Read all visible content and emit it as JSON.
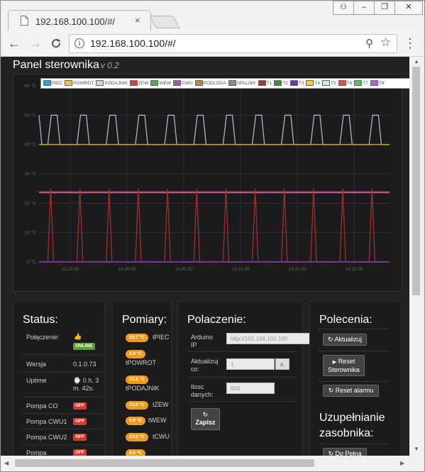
{
  "browser": {
    "tab_title": "192.168.100.100/#/",
    "url": "192.168.100.100/#/",
    "close_glyph": "×",
    "back_glyph": "←",
    "forward_glyph": "→",
    "reload_glyph": "C",
    "info_glyph": "i",
    "zoom_glyph": "⚲",
    "star_glyph": "☆",
    "menu_glyph": "⋮",
    "user_glyph": "⚇",
    "minimize_glyph": "–",
    "restore_glyph": "❐",
    "closewin_glyph": "✕"
  },
  "header": {
    "title": "Panel sterownika",
    "version": "v 0.2"
  },
  "chart_data": {
    "type": "line",
    "ylim": [
      0,
      60
    ],
    "y_ticks": [
      "60 °C",
      "50 °C",
      "40 °C",
      "30 °C",
      "20 °C",
      "10 °C",
      "0 °C"
    ],
    "x_ticks": [
      "13:29:30",
      "13:30:00",
      "13:30:30",
      "13:31:00",
      "13:31:30",
      "13:32:00"
    ],
    "grid": true,
    "legend_position": "top",
    "legend": [
      "PIEC",
      "POWROT",
      "PODAJNIK",
      "ZEW",
      "WEW",
      "CWU",
      "PODLOGA",
      "SPALINY",
      "T1",
      "T2",
      "T3",
      "T4",
      "T5",
      "T6",
      "T7",
      "T8"
    ],
    "legend_colors": [
      "#2aa3d8",
      "#f4c542",
      "#c9d3dd",
      "#d43f3a",
      "#4cae4c",
      "#9b59b6",
      "#b08f3a",
      "#7f8c99",
      "#a33",
      "#3a8f3a",
      "#6a3aa3",
      "#f4d03f",
      "#d0e8f0",
      "#e05050",
      "#60c060",
      "#b060e0"
    ],
    "series": [
      {
        "name": "PODAJNIK",
        "color": "#a9b8c6",
        "pattern": "pulse",
        "low": 40,
        "high": 50,
        "pulses": 12
      },
      {
        "name": "POWROT",
        "color": "#c9a227",
        "pattern": "flat",
        "value": 40
      },
      {
        "name": "PIEC",
        "color": "#d9468d",
        "pattern": "flat",
        "value": 23.7
      },
      {
        "name": "T1",
        "color": "#9e2f2f",
        "pattern": "spike",
        "low": 0,
        "high": 25,
        "pulses": 12
      },
      {
        "name": "CWU",
        "color": "#8e44ad",
        "pattern": "flat",
        "value": 0
      }
    ]
  },
  "status": {
    "title": "Status:",
    "rows": [
      {
        "label": "Połączenie:",
        "value": "",
        "badge": "ONLINE",
        "icon": "thumbs-up-icon",
        "icon_glyph": "👍"
      },
      {
        "label": "Wersja",
        "value": "0.1.0.73"
      },
      {
        "label": "Uptime",
        "value": "⌚ 0 h. 3 m. 42s."
      },
      {
        "label": "Pompa CO",
        "badge": "OFF"
      },
      {
        "label": "Pompa CWU1",
        "badge": "OFF"
      },
      {
        "label": "Pompa CWU2",
        "badge": "OFF"
      },
      {
        "label": "Pompa",
        "badge": "OFF"
      }
    ]
  },
  "pomiary": {
    "title": "Pomiary:",
    "items": [
      {
        "value": "23.7 °C",
        "label": "tPIEC"
      },
      {
        "value": "0.0 °C",
        "label": "tPOWROT"
      },
      {
        "value": "23.6 °C",
        "label": "tPODAJNIK"
      },
      {
        "value": "23.8 °C",
        "label": "tZEW"
      },
      {
        "value": "0.0 °C",
        "label": "tWEW"
      },
      {
        "value": "23.5 °C",
        "label": "tCWU"
      },
      {
        "value": "0.0 °C",
        "label": ""
      }
    ]
  },
  "polaczenie": {
    "title": "Polaczenie:",
    "ip_label": "Arduino IP",
    "ip_placeholder": "http://192.168.100.100",
    "update_label": "Aktualizuj co:",
    "update_value": "1",
    "update_unit": "s.",
    "count_label": "Ilosc danych:",
    "count_value": "600",
    "save_label": "Zapisz",
    "save_icon": "↻"
  },
  "polecenia": {
    "title": "Polecenia:",
    "refresh_label": "Aktualizuj",
    "refresh_icon": "↻",
    "reset_ctrl_label": "Reset Sterownika",
    "reset_ctrl_icon": "▶",
    "reset_alarm_label": "Reset alarmu",
    "reset_alarm_icon": "↻",
    "subtitle": "Uzupełnianie zasobnika:",
    "full_label": "Do Pełna",
    "full_icon": "↻"
  }
}
